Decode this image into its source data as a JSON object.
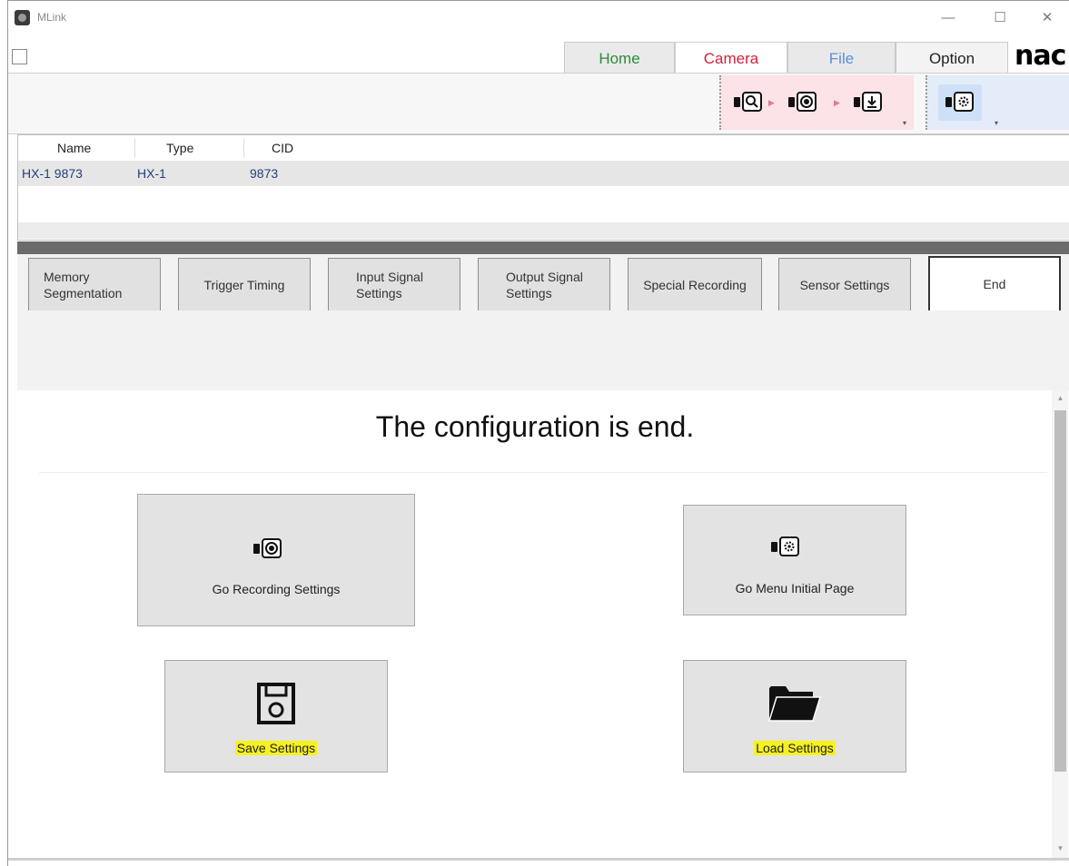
{
  "window": {
    "title": "MLink",
    "minimize_glyph": "—",
    "maximize_glyph": "☐",
    "close_glyph": "✕"
  },
  "ribbon": {
    "tabs": [
      {
        "label": "Home",
        "color": "#2f8a3c"
      },
      {
        "label": "Camera",
        "color": "#d0213c",
        "active": true
      },
      {
        "label": "File",
        "color": "#5b8fd8"
      },
      {
        "label": "Option",
        "color": "#222222"
      }
    ],
    "logo_text": "nac",
    "tools": [
      "camera-search-icon",
      "camera-record-icon",
      "camera-download-icon",
      "camera-settings-icon"
    ]
  },
  "camera_list": {
    "columns": [
      "Name",
      "Type",
      "CID"
    ],
    "rows": [
      {
        "name": "HX-1 9873",
        "type": "HX-1",
        "cid": "9873"
      }
    ]
  },
  "steps": [
    {
      "label_line1": "Memory",
      "label_line2": "Segmentation"
    },
    {
      "label_line1": "Trigger Timing",
      "label_line2": ""
    },
    {
      "label_line1": "Input Signal",
      "label_line2": "Settings"
    },
    {
      "label_line1": "Output Signal",
      "label_line2": "Settings"
    },
    {
      "label_line1": "Special Recording",
      "label_line2": ""
    },
    {
      "label_line1": "Sensor Settings",
      "label_line2": ""
    },
    {
      "label_line1": "End",
      "label_line2": "",
      "active": true
    }
  ],
  "content": {
    "heading": "The configuration is end.",
    "buttons": {
      "go_recording": "Go Recording Settings",
      "go_menu": "Go Menu Initial Page",
      "save": "Save Settings",
      "load": "Load Settings"
    },
    "highlight_color": "#f6f21f"
  }
}
